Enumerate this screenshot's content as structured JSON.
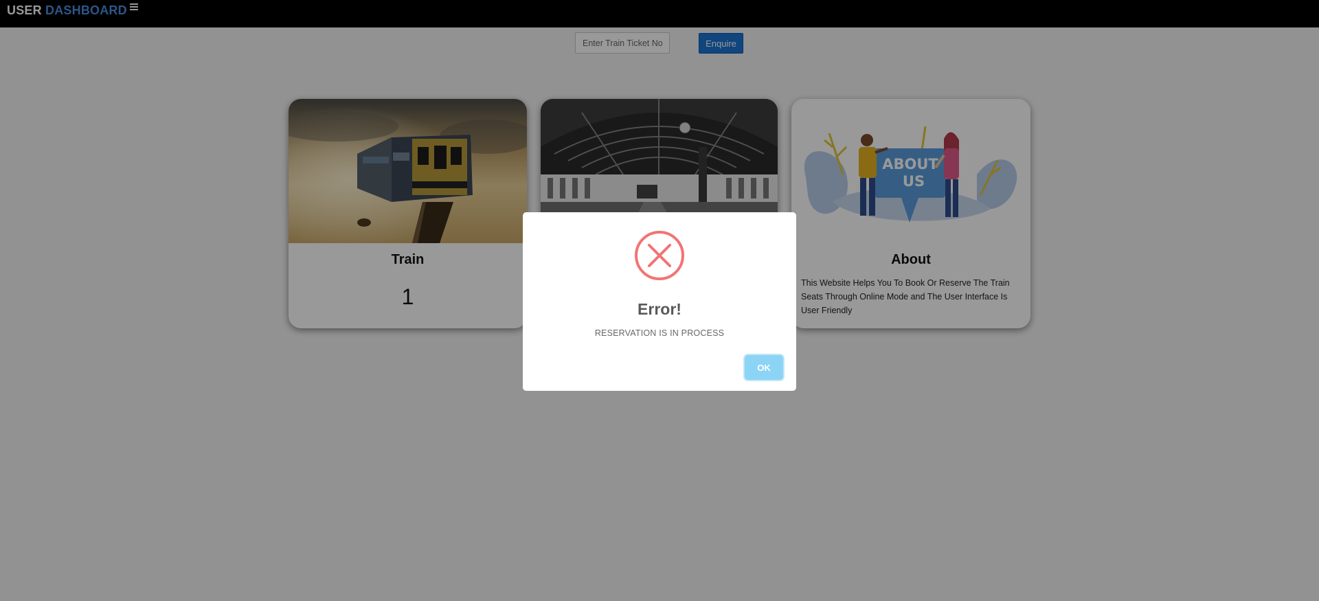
{
  "header": {
    "brand_user": "USER",
    "brand_dashboard": "DASHBOARD",
    "menu_icon": "hamburger-menu-icon"
  },
  "search": {
    "placeholder": "Enter Train Ticket No.",
    "value": "",
    "button_label": "Enquire"
  },
  "cards": [
    {
      "title": "Train",
      "count": "1",
      "image": "train-photo"
    },
    {
      "title": "",
      "count": "",
      "image": "station-photo"
    },
    {
      "title": "About",
      "image": "about-us-illustration",
      "image_text": "ABOUT US",
      "description": "This Website Helps You To Book Or Reserve The Train Seats Through Online Mode and The User Interface Is User Friendly"
    }
  ],
  "modal": {
    "icon": "error-x-icon",
    "title": "Error!",
    "message": "RESERVATION IS IN PROCESS",
    "ok_label": "OK"
  },
  "colors": {
    "accent": "#1b74d3",
    "brand_blue": "#4a90e2",
    "error_red": "#f27474",
    "ok_button": "#8cd4f5"
  }
}
